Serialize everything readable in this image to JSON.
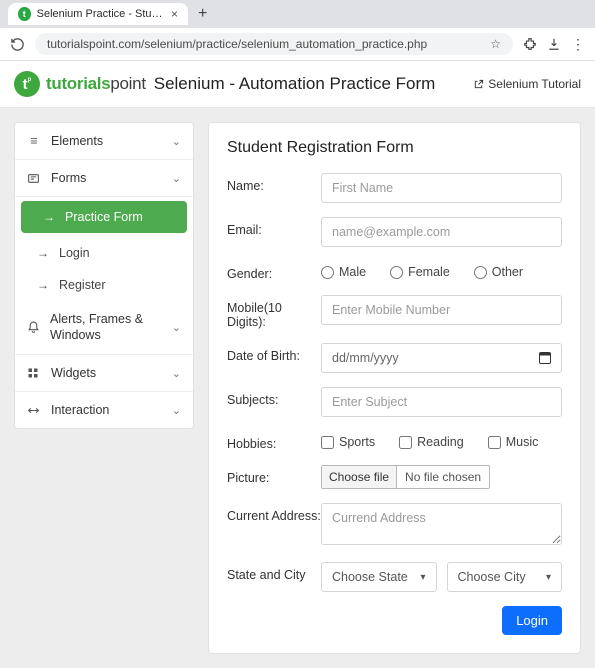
{
  "browser": {
    "tab_title": "Selenium Practice - Student I",
    "url": "tutorialspoint.com/selenium/practice/selenium_automation_practice.php"
  },
  "header": {
    "logo_green": "tutorials",
    "logo_gray": "point",
    "title": "Selenium - Automation Practice Form",
    "link": "Selenium Tutorial"
  },
  "sidebar": {
    "items": [
      {
        "label": "Elements",
        "icon": "≡"
      },
      {
        "label": "Forms",
        "icon": "▭"
      },
      {
        "label": "Alerts, Frames & Windows",
        "icon": "bell"
      },
      {
        "label": "Widgets",
        "icon": "grid"
      },
      {
        "label": "Interaction",
        "icon": "swap"
      }
    ],
    "forms_sub": [
      {
        "label": "Practice Form",
        "active": true
      },
      {
        "label": "Login",
        "active": false
      },
      {
        "label": "Register",
        "active": false
      }
    ]
  },
  "form": {
    "title": "Student Registration Form",
    "labels": {
      "name": "Name:",
      "email": "Email:",
      "gender": "Gender:",
      "mobile": "Mobile(10 Digits):",
      "dob": "Date of Birth:",
      "subjects": "Subjects:",
      "hobbies": "Hobbies:",
      "picture": "Picture:",
      "address": "Current Address:",
      "statecity": "State and City"
    },
    "placeholders": {
      "name": "First Name",
      "email": "name@example.com",
      "mobile": "Enter Mobile Number",
      "dob": "dd/mm/yyyy",
      "subjects": "Enter Subject",
      "address": "Currend Address"
    },
    "gender": {
      "male": "Male",
      "female": "Female",
      "other": "Other"
    },
    "hobbies": {
      "sports": "Sports",
      "reading": "Reading",
      "music": "Music"
    },
    "file": {
      "button": "Choose file",
      "status": "No file chosen"
    },
    "selects": {
      "state": "Choose State",
      "city": "Choose City"
    },
    "submit": "Login"
  }
}
